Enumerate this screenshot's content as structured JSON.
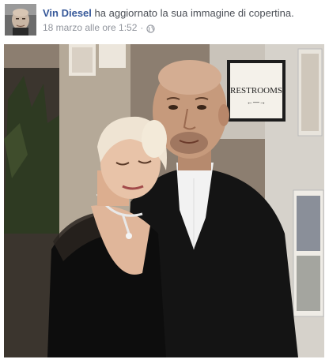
{
  "post": {
    "author": "Vin Diesel",
    "action_text": "ha aggiornato la sua immagine di copertina.",
    "timestamp": "18 marzo alle ore 1:52",
    "separator": "·",
    "privacy_icon": "globe-icon"
  },
  "photo": {
    "sign_text": "RESTROOMS",
    "sign_arrow": "←—→"
  },
  "colors": {
    "author_link": "#365899",
    "body_text": "#4b4f56",
    "meta_text": "#90949c"
  }
}
